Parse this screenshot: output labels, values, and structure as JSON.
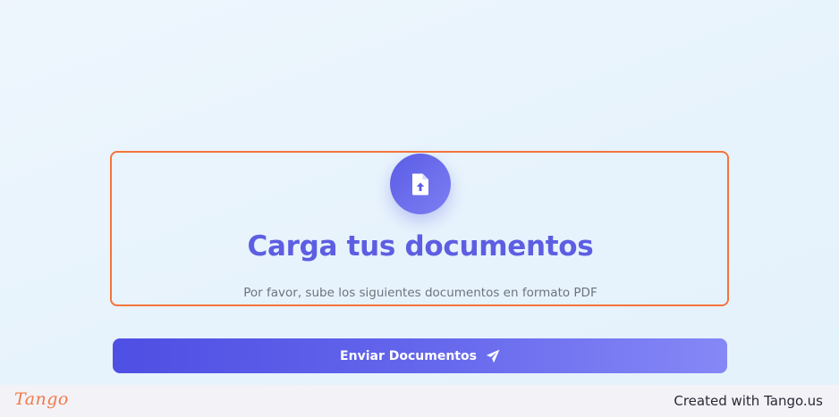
{
  "upload": {
    "icon": "file-upload-icon",
    "title": "Carga tus documentos",
    "subtitle": "Por favor, sube los siguientes documentos en formato PDF"
  },
  "actions": {
    "submit_label": "Enviar Documentos",
    "submit_icon": "paper-plane-icon"
  },
  "footer": {
    "logo_text": "Tango",
    "credit": "Created with Tango.us"
  },
  "colors": {
    "accent": "#5d5ee2",
    "highlight": "#f4743b",
    "logo": "#f07a48"
  }
}
